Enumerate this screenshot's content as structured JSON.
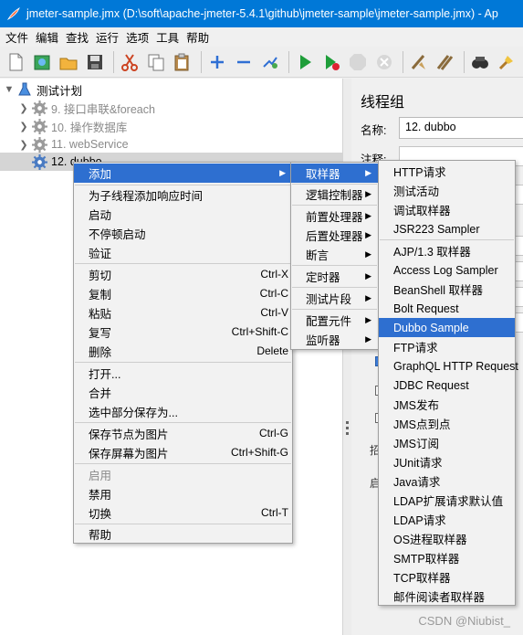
{
  "window": {
    "title": "jmeter-sample.jmx (D:\\soft\\apache-jmeter-5.4.1\\github\\jmeter-sample\\jmeter-sample.jmx) - Ap"
  },
  "menubar": [
    "文件",
    "编辑",
    "查找",
    "运行",
    "选项",
    "工具",
    "帮助"
  ],
  "toolbar": {
    "icons": [
      "new-icon",
      "templates-icon",
      "open-icon",
      "save-icon",
      "cut-icon",
      "copy-icon",
      "paste-icon",
      "expand-icon",
      "collapse-icon",
      "toggle-icon",
      "start-icon",
      "start-no-pause-icon",
      "stop-icon",
      "shutdown-icon",
      "clear-icon",
      "clear-all-icon",
      "search-icon",
      "reset-search-icon",
      "function-helper-icon"
    ]
  },
  "tree": {
    "root": "测试计划",
    "items": [
      {
        "label": "9. 接口串联&foreach",
        "icon": "gear-icon"
      },
      {
        "label": "10. 操作数据库",
        "icon": "gear-icon"
      },
      {
        "label": "11. webService",
        "icon": "gear-icon"
      },
      {
        "label": "12. dubbo",
        "icon": "gear-icon"
      }
    ]
  },
  "right_panel": {
    "title": "线程组",
    "name_label": "名称:",
    "name_value": "12. dubbo",
    "comment_label": "注释:",
    "fragments": [
      "招",
      "启"
    ]
  },
  "context_menu": {
    "items": [
      {
        "label": "添加",
        "submenu": true,
        "highlighted": true
      },
      {
        "label": "为子线程添加响应时间"
      },
      {
        "label": "启动"
      },
      {
        "label": "不停顿启动"
      },
      {
        "label": "验证"
      },
      {
        "label": "剪切",
        "shortcut": "Ctrl-X"
      },
      {
        "label": "复制",
        "shortcut": "Ctrl-C"
      },
      {
        "label": "粘贴",
        "shortcut": "Ctrl-V"
      },
      {
        "label": "复写",
        "shortcut": "Ctrl+Shift-C"
      },
      {
        "label": "删除",
        "shortcut": "Delete"
      },
      {
        "label": "打开..."
      },
      {
        "label": "合并"
      },
      {
        "label": "选中部分保存为..."
      },
      {
        "label": "保存节点为图片",
        "shortcut": "Ctrl-G"
      },
      {
        "label": "保存屏幕为图片",
        "shortcut": "Ctrl+Shift-G"
      },
      {
        "label": "启用",
        "disabled": true
      },
      {
        "label": "禁用"
      },
      {
        "label": "切换",
        "shortcut": "Ctrl-T"
      },
      {
        "label": "帮助"
      }
    ]
  },
  "add_submenu": {
    "items": [
      {
        "label": "取样器",
        "highlighted": true
      },
      {
        "label": "逻辑控制器"
      },
      {
        "label": "前置处理器"
      },
      {
        "label": "后置处理器"
      },
      {
        "label": "断言"
      },
      {
        "label": "定时器"
      },
      {
        "label": "测试片段"
      },
      {
        "label": "配置元件"
      },
      {
        "label": "监听器"
      }
    ]
  },
  "sampler_submenu": {
    "items": [
      {
        "label": "HTTP请求"
      },
      {
        "label": "测试活动"
      },
      {
        "label": "调试取样器"
      },
      {
        "label": "JSR223 Sampler"
      },
      {
        "label": "AJP/1.3 取样器"
      },
      {
        "label": "Access Log Sampler"
      },
      {
        "label": "BeanShell 取样器"
      },
      {
        "label": "Bolt Request"
      },
      {
        "label": "Dubbo Sample",
        "highlighted": true
      },
      {
        "label": "FTP请求"
      },
      {
        "label": "GraphQL HTTP Request"
      },
      {
        "label": "JDBC Request"
      },
      {
        "label": "JMS发布"
      },
      {
        "label": "JMS点到点"
      },
      {
        "label": "JMS订阅"
      },
      {
        "label": "JUnit请求"
      },
      {
        "label": "Java请求"
      },
      {
        "label": "LDAP扩展请求默认值"
      },
      {
        "label": "LDAP请求"
      },
      {
        "label": "OS进程取样器"
      },
      {
        "label": "SMTP取样器"
      },
      {
        "label": "TCP取样器"
      },
      {
        "label": "邮件阅读者取样器"
      }
    ]
  },
  "watermark": "CSDN @Niubist_",
  "colors": {
    "titlebar": "#0078d7",
    "highlight": "#2e6fd0",
    "selected_row": "#d5d5d5"
  }
}
